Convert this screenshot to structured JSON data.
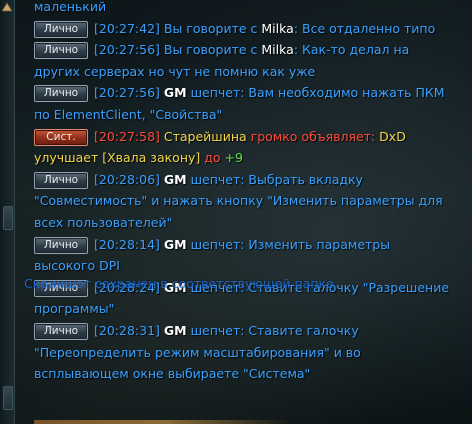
{
  "chat": {
    "channel_private": "Лично",
    "channel_system": "Сист.",
    "lines": {
      "l0": {
        "text": "маленький"
      },
      "m1": {
        "time": "[20:27:42]",
        "prefix": "Вы говорите с ",
        "target": "Milka",
        "text": ": Все отдаленно типо"
      },
      "m2": {
        "time": "[20:27:56]",
        "prefix": "Вы говорите с ",
        "target": "Milka",
        "text": ": Как-то делал на"
      },
      "m2b": {
        "text": "других серверах но чут не помню как уже"
      },
      "m3": {
        "time": "[20:27:56]",
        "sender": "GM",
        "verb": " шепчет: ",
        "text": "Вам необходимо нажать ПКМ"
      },
      "m3b": {
        "text": "по ElementClient, \"Свойства\""
      },
      "m4": {
        "time": "[20:27:58]",
        "sender": "Старейшина",
        "verb": " громко объявляет: ",
        "text": "DxD"
      },
      "m4b": {
        "pre": "улучшает ",
        "item": "[Хвала закону]",
        "mid": " до ",
        "value": "+9"
      },
      "m5": {
        "time": "[20:28:06]",
        "sender": "GM",
        "verb": " шепчет: ",
        "text": "Выбрать вкладку"
      },
      "m5b": {
        "text": "\"Совместимость\" и нажать кнопку \"Изменить параметры для"
      },
      "m5c": {
        "text": "всех пользователей\""
      },
      "m6": {
        "time": "[20:28:14]",
        "sender": "GM",
        "verb": " шепчет: ",
        "text": "Изменить параметры"
      },
      "m6b": {
        "text": "высокого DPI"
      },
      "m7": {
        "time": "[20:28:24]",
        "sender": "GM",
        "verb": " шепчет: ",
        "text": "Ставите галочку \"Разрешение"
      },
      "m7b": {
        "text": "программы\""
      },
      "m8": {
        "time": "[20:28:31]",
        "sender": "GM",
        "verb": " шепчет: ",
        "text": "Ставите галочку"
      },
      "m8b": {
        "text": "\"Переопределить режим масштабирования\" и во"
      },
      "m8c": {
        "text": "всплывающем окне выбираете \"Система\""
      }
    }
  },
  "overlay": {
    "screenshot_notice": "Скриншот сохранен в соответствующей папке"
  },
  "colors": {
    "chat_blue": "#3aa0ff",
    "system_red": "#ff4a3a",
    "announce_yellow": "#f2d64a",
    "gm_blue": "#6fb8ff",
    "plus_green": "#62e24a"
  },
  "icons": {
    "scroll_up": "triangle-up-icon"
  }
}
